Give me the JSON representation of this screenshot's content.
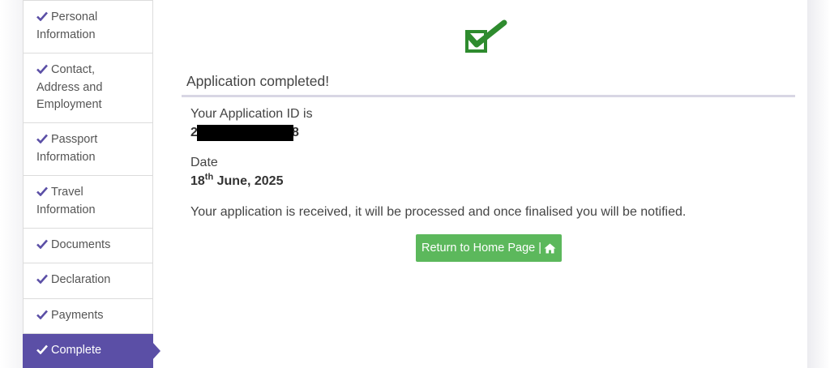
{
  "sidebar": {
    "steps": [
      {
        "line1": "Personal",
        "line2": "Information",
        "line3": ""
      },
      {
        "line1": "Contact,",
        "line2": "Address and",
        "line3": "Employment"
      },
      {
        "line1": "Passport",
        "line2": "Information",
        "line3": ""
      },
      {
        "line1": "Travel",
        "line2": "Information",
        "line3": ""
      },
      {
        "line1": "Documents",
        "line2": "",
        "line3": ""
      },
      {
        "line1": "Declaration",
        "line2": "",
        "line3": ""
      },
      {
        "line1": "Payments",
        "line2": "",
        "line3": ""
      },
      {
        "line1": "Complete",
        "line2": "",
        "line3": ""
      }
    ],
    "active_step": "Complete",
    "check_icon": "check-icon",
    "check_color": "#5b4fa6"
  },
  "main": {
    "success_icon": "green-checkmark-icon",
    "success_color": "#2e8b2e",
    "heading": "Application completed!",
    "app_id_label": "Your Application ID is",
    "app_id_first_char": "2",
    "app_id_last_char": "8",
    "date_label": "Date",
    "date_day": "18",
    "date_suffix": "th",
    "date_rest": " June, 2025",
    "message": "Your application is received, it will be processed and once finalised you will be notified.",
    "home_button": "Return to Home Page |",
    "home_icon": "home-icon",
    "button_color": "#5cb85c"
  }
}
